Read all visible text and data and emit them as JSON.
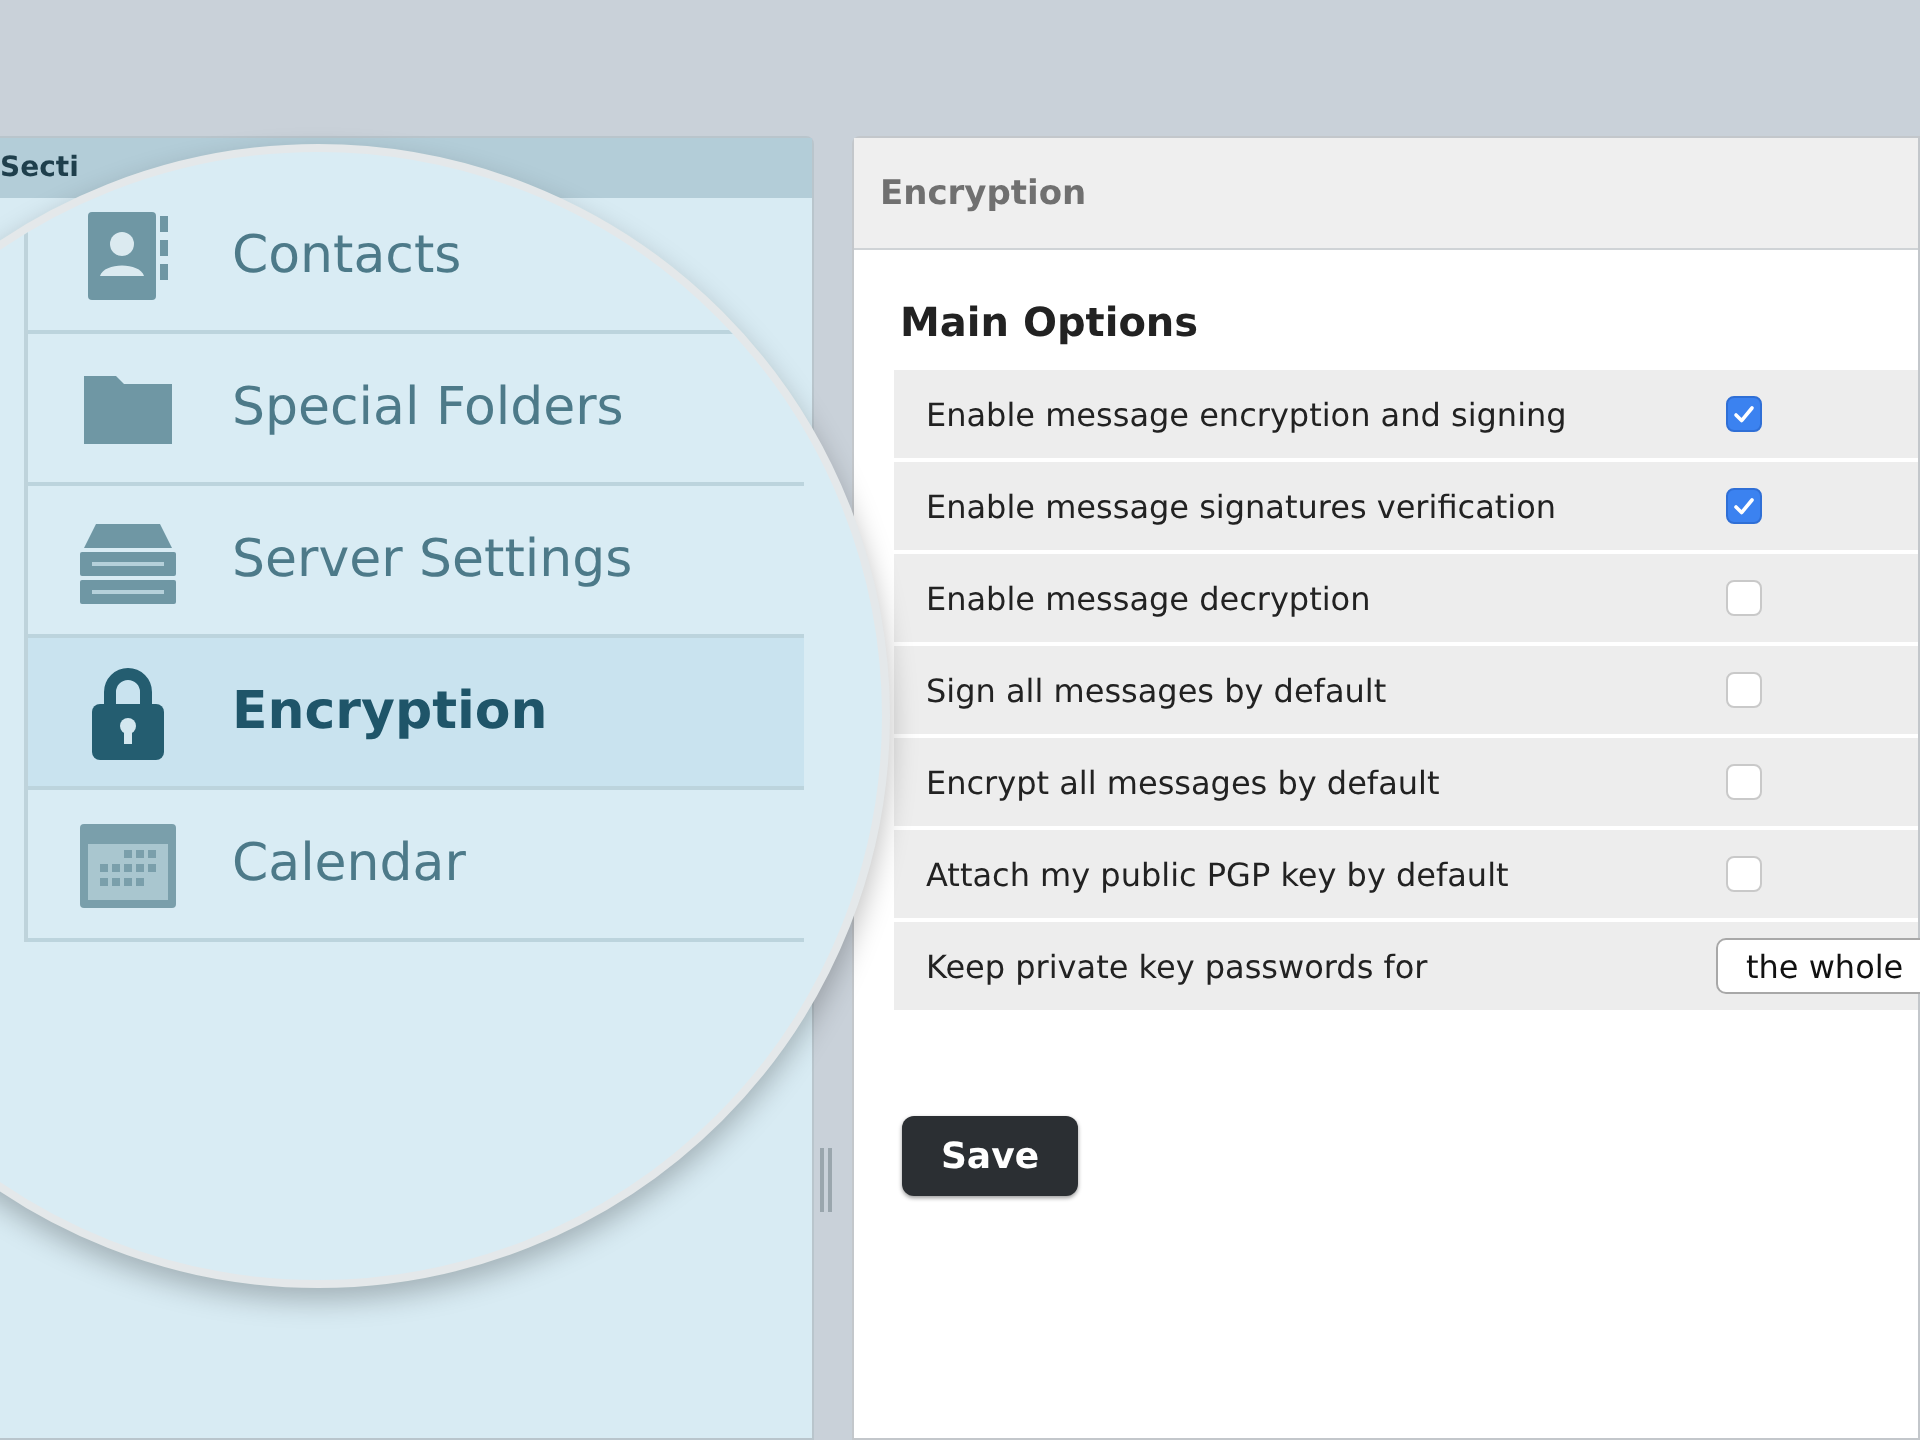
{
  "sidebar": {
    "header": "Secti",
    "items": [
      {
        "label": "Contacts",
        "selected": false
      },
      {
        "label": "Special Folders",
        "selected": false
      },
      {
        "label": "Server Settings",
        "selected": false
      },
      {
        "label": "Encryption",
        "selected": true
      },
      {
        "label": "Calendar",
        "selected": false
      }
    ]
  },
  "panel": {
    "title": "Encryption",
    "section_title": "Main Options",
    "options": [
      {
        "kind": "checkbox",
        "label": "Enable message encryption and signing",
        "checked": true
      },
      {
        "kind": "checkbox",
        "label": "Enable message signatures verification",
        "checked": true
      },
      {
        "kind": "checkbox",
        "label": "Enable message decryption",
        "checked": false
      },
      {
        "kind": "checkbox",
        "label": "Sign all messages by default",
        "checked": false
      },
      {
        "kind": "checkbox",
        "label": "Encrypt all messages by default",
        "checked": false
      },
      {
        "kind": "checkbox",
        "label": "Attach my public PGP key by default",
        "checked": false
      },
      {
        "kind": "select",
        "label": "Keep private key passwords for",
        "value": "the whole"
      }
    ],
    "save_button": "Save"
  }
}
